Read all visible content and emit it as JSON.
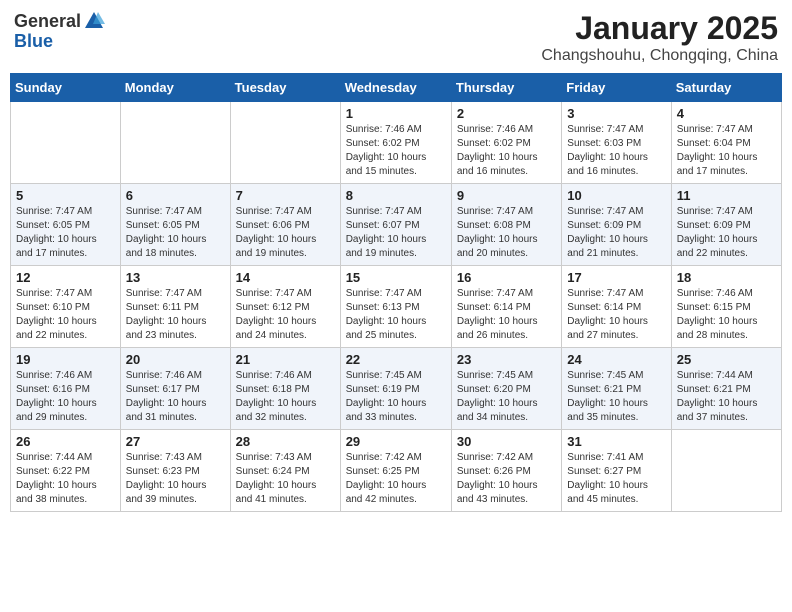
{
  "header": {
    "logo_general": "General",
    "logo_blue": "Blue",
    "title": "January 2025",
    "subtitle": "Changshouhu, Chongqing, China"
  },
  "days_of_week": [
    "Sunday",
    "Monday",
    "Tuesday",
    "Wednesday",
    "Thursday",
    "Friday",
    "Saturday"
  ],
  "weeks": [
    [
      {
        "day": "",
        "info": ""
      },
      {
        "day": "",
        "info": ""
      },
      {
        "day": "",
        "info": ""
      },
      {
        "day": "1",
        "info": "Sunrise: 7:46 AM\nSunset: 6:02 PM\nDaylight: 10 hours\nand 15 minutes."
      },
      {
        "day": "2",
        "info": "Sunrise: 7:46 AM\nSunset: 6:02 PM\nDaylight: 10 hours\nand 16 minutes."
      },
      {
        "day": "3",
        "info": "Sunrise: 7:47 AM\nSunset: 6:03 PM\nDaylight: 10 hours\nand 16 minutes."
      },
      {
        "day": "4",
        "info": "Sunrise: 7:47 AM\nSunset: 6:04 PM\nDaylight: 10 hours\nand 17 minutes."
      }
    ],
    [
      {
        "day": "5",
        "info": "Sunrise: 7:47 AM\nSunset: 6:05 PM\nDaylight: 10 hours\nand 17 minutes."
      },
      {
        "day": "6",
        "info": "Sunrise: 7:47 AM\nSunset: 6:05 PM\nDaylight: 10 hours\nand 18 minutes."
      },
      {
        "day": "7",
        "info": "Sunrise: 7:47 AM\nSunset: 6:06 PM\nDaylight: 10 hours\nand 19 minutes."
      },
      {
        "day": "8",
        "info": "Sunrise: 7:47 AM\nSunset: 6:07 PM\nDaylight: 10 hours\nand 19 minutes."
      },
      {
        "day": "9",
        "info": "Sunrise: 7:47 AM\nSunset: 6:08 PM\nDaylight: 10 hours\nand 20 minutes."
      },
      {
        "day": "10",
        "info": "Sunrise: 7:47 AM\nSunset: 6:09 PM\nDaylight: 10 hours\nand 21 minutes."
      },
      {
        "day": "11",
        "info": "Sunrise: 7:47 AM\nSunset: 6:09 PM\nDaylight: 10 hours\nand 22 minutes."
      }
    ],
    [
      {
        "day": "12",
        "info": "Sunrise: 7:47 AM\nSunset: 6:10 PM\nDaylight: 10 hours\nand 22 minutes."
      },
      {
        "day": "13",
        "info": "Sunrise: 7:47 AM\nSunset: 6:11 PM\nDaylight: 10 hours\nand 23 minutes."
      },
      {
        "day": "14",
        "info": "Sunrise: 7:47 AM\nSunset: 6:12 PM\nDaylight: 10 hours\nand 24 minutes."
      },
      {
        "day": "15",
        "info": "Sunrise: 7:47 AM\nSunset: 6:13 PM\nDaylight: 10 hours\nand 25 minutes."
      },
      {
        "day": "16",
        "info": "Sunrise: 7:47 AM\nSunset: 6:14 PM\nDaylight: 10 hours\nand 26 minutes."
      },
      {
        "day": "17",
        "info": "Sunrise: 7:47 AM\nSunset: 6:14 PM\nDaylight: 10 hours\nand 27 minutes."
      },
      {
        "day": "18",
        "info": "Sunrise: 7:46 AM\nSunset: 6:15 PM\nDaylight: 10 hours\nand 28 minutes."
      }
    ],
    [
      {
        "day": "19",
        "info": "Sunrise: 7:46 AM\nSunset: 6:16 PM\nDaylight: 10 hours\nand 29 minutes."
      },
      {
        "day": "20",
        "info": "Sunrise: 7:46 AM\nSunset: 6:17 PM\nDaylight: 10 hours\nand 31 minutes."
      },
      {
        "day": "21",
        "info": "Sunrise: 7:46 AM\nSunset: 6:18 PM\nDaylight: 10 hours\nand 32 minutes."
      },
      {
        "day": "22",
        "info": "Sunrise: 7:45 AM\nSunset: 6:19 PM\nDaylight: 10 hours\nand 33 minutes."
      },
      {
        "day": "23",
        "info": "Sunrise: 7:45 AM\nSunset: 6:20 PM\nDaylight: 10 hours\nand 34 minutes."
      },
      {
        "day": "24",
        "info": "Sunrise: 7:45 AM\nSunset: 6:21 PM\nDaylight: 10 hours\nand 35 minutes."
      },
      {
        "day": "25",
        "info": "Sunrise: 7:44 AM\nSunset: 6:21 PM\nDaylight: 10 hours\nand 37 minutes."
      }
    ],
    [
      {
        "day": "26",
        "info": "Sunrise: 7:44 AM\nSunset: 6:22 PM\nDaylight: 10 hours\nand 38 minutes."
      },
      {
        "day": "27",
        "info": "Sunrise: 7:43 AM\nSunset: 6:23 PM\nDaylight: 10 hours\nand 39 minutes."
      },
      {
        "day": "28",
        "info": "Sunrise: 7:43 AM\nSunset: 6:24 PM\nDaylight: 10 hours\nand 41 minutes."
      },
      {
        "day": "29",
        "info": "Sunrise: 7:42 AM\nSunset: 6:25 PM\nDaylight: 10 hours\nand 42 minutes."
      },
      {
        "day": "30",
        "info": "Sunrise: 7:42 AM\nSunset: 6:26 PM\nDaylight: 10 hours\nand 43 minutes."
      },
      {
        "day": "31",
        "info": "Sunrise: 7:41 AM\nSunset: 6:27 PM\nDaylight: 10 hours\nand 45 minutes."
      },
      {
        "day": "",
        "info": ""
      }
    ]
  ]
}
